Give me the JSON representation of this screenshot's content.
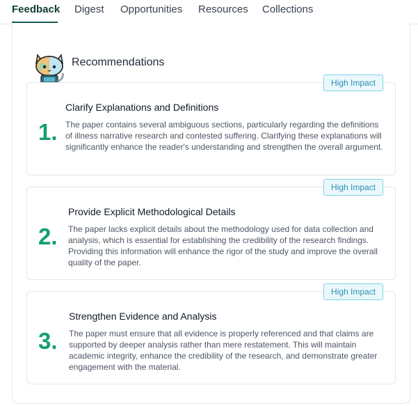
{
  "tabs": [
    "Feedback",
    "Digest",
    "Opportunities",
    "Resources",
    "Collections"
  ],
  "section": {
    "title": "Recommendations"
  },
  "recommendations": [
    {
      "number": "1.",
      "badge": "High Impact",
      "title": "Clarify Explanations and Definitions",
      "body": "The paper contains several ambiguous sections, particularly regarding the definitions of illness narrative research and contested suffering. Clarifying these explanations will significantly enhance the reader's understanding and strengthen the overall argument."
    },
    {
      "number": "2.",
      "badge": "High Impact",
      "title": "Provide Explicit Methodological Details",
      "body": "The paper lacks explicit details about the methodology used for data collection and analysis, which is essential for establishing the credibility of the research findings. Providing this information will enhance the rigor of the study and improve the overall quality of the paper."
    },
    {
      "number": "3.",
      "badge": "High Impact",
      "title": "Strengthen Evidence and Analysis",
      "body": "The paper must ensure that all evidence is properly referenced and that claims are supported by deeper analysis rather than mere restatement. This will maintain academic integrity, enhance the credibility of the research, and demonstrate greater engagement with the material."
    }
  ],
  "colors": {
    "accent_green": "#169e72",
    "badge_border": "#7dd3e8",
    "badge_text": "#2b8fb0",
    "active_tab": "#0f3d34"
  }
}
